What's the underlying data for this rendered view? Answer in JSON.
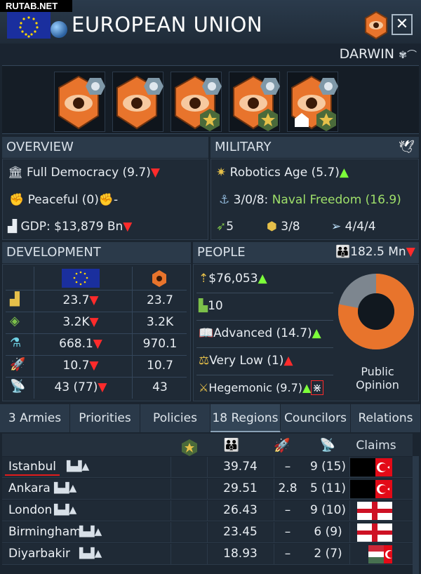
{
  "watermark": "RUTAB.NET",
  "header": {
    "title": "EUROPEAN UNION",
    "close_label": "✕"
  },
  "leader": {
    "name": "DARWIN",
    "icons": "✾⌒"
  },
  "overview": {
    "title": "OVERVIEW",
    "democracy": "Full Democracy (9.7)",
    "cohesion": "Peaceful (0)",
    "gdp": "GDP: $13,879 Bn"
  },
  "military": {
    "title": "MILITARY",
    "tech_age": "Robotics Age (5.7)",
    "navy_counts": "3/0/8:",
    "navy_doctrine": "Naval Freedom (16.9)",
    "missiles": "5",
    "stars": "3/8",
    "space": "4/4/4"
  },
  "development": {
    "title": "DEVELOPMENT",
    "rows": [
      {
        "icon": "economy-icon",
        "own": "23.7",
        "dir": "down",
        "other": "23.7"
      },
      {
        "icon": "welfare-icon",
        "own": "3.2K",
        "dir": "down",
        "other": "3.2K"
      },
      {
        "icon": "knowledge-icon",
        "own": "668.1",
        "dir": "down",
        "other": "970.1"
      },
      {
        "icon": "space-icon",
        "own": "10.7",
        "dir": "down",
        "other": "10.7"
      },
      {
        "icon": "radar-icon",
        "own": "43 (77)",
        "dir": "down",
        "other": "43"
      }
    ]
  },
  "people": {
    "title": "PEOPLE",
    "population": "182.5 Mn",
    "gdp_per_capita": "$76,053",
    "inequality": "10",
    "education": "Advanced (14.7)",
    "unrest": "Very Low (1)",
    "hegemony": "Hegemonic (9.7)",
    "opinion_label": "Public Opinion",
    "opinion_share": 0.78
  },
  "tabs": [
    "3 Armies",
    "Priorities",
    "Policies",
    "18 Regions",
    "Councilors",
    "Relations"
  ],
  "regions": {
    "claims_label": "Claims",
    "rows": [
      {
        "name": "Istanbul",
        "pop": "39.74",
        "mil": "–",
        "sat": "9 (15)",
        "claims": [
          "tr"
        ]
      },
      {
        "name": "Ankara",
        "pop": "29.51",
        "mil": "2.8",
        "sat": "5 (11)",
        "claims": [
          "tr"
        ]
      },
      {
        "name": "London",
        "pop": "26.43",
        "mil": "–",
        "sat": "9 (10)",
        "claims": [
          "en"
        ]
      },
      {
        "name": "Birmingham",
        "pop": "23.45",
        "mil": "–",
        "sat": "6 (9)",
        "claims": [
          "en"
        ]
      },
      {
        "name": "Diyarbakir",
        "pop": "18.93",
        "mil": "–",
        "sat": "2 (7)",
        "claims": [
          "hu",
          "tr"
        ]
      }
    ]
  },
  "colors": {
    "accent_orange": "#e8742c",
    "up": "#7cff3a",
    "down": "#ff2b2b",
    "eu_blue": "#1a2f9e"
  }
}
